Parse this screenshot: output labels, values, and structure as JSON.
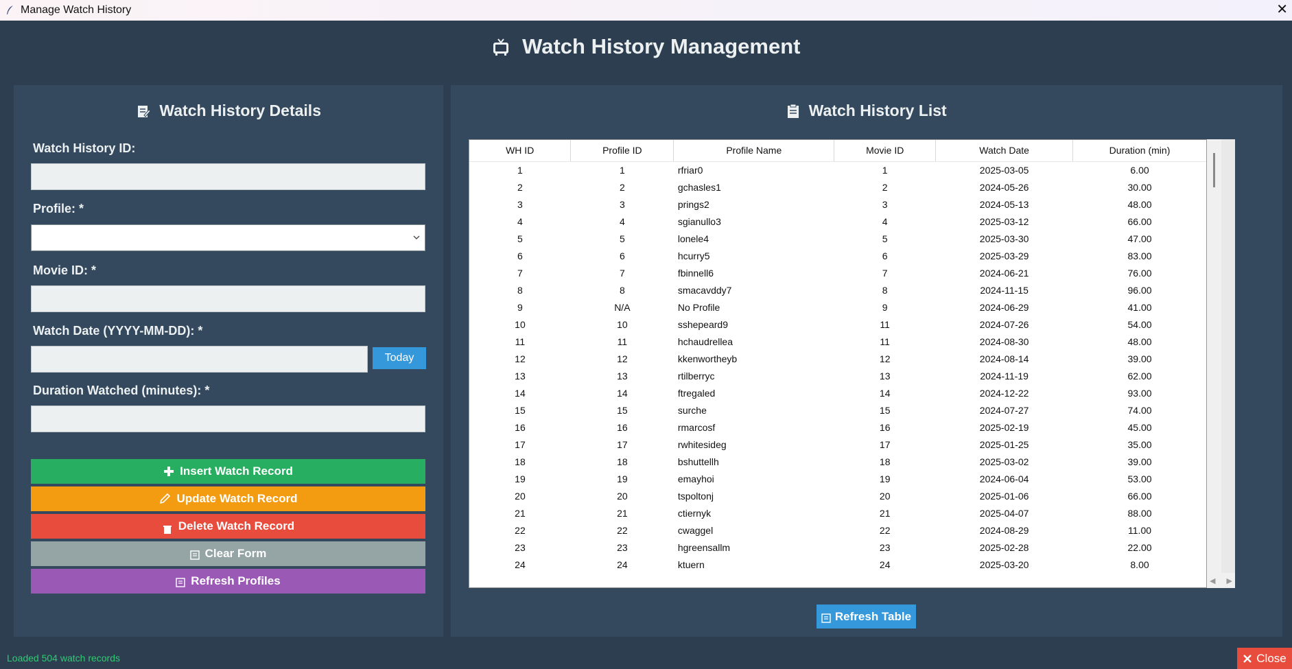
{
  "window": {
    "title": "Manage Watch History"
  },
  "header": {
    "title": "Watch History Management"
  },
  "details": {
    "title": "Watch History Details",
    "labels": {
      "wh_id": "Watch History ID:",
      "profile": "Profile: *",
      "movie_id": "Movie ID: *",
      "watch_date": "Watch Date (YYYY-MM-DD): *",
      "duration": "Duration Watched (minutes): *"
    },
    "values": {
      "wh_id": "",
      "profile": "",
      "movie_id": "",
      "watch_date": "",
      "duration": ""
    },
    "today_label": "Today",
    "buttons": {
      "insert": "Insert Watch Record",
      "update": "Update Watch Record",
      "delete": "Delete Watch Record",
      "clear": "Clear Form",
      "refresh_profiles": "Refresh Profiles"
    }
  },
  "list": {
    "title": "Watch History List",
    "columns": [
      "WH ID",
      "Profile ID",
      "Profile Name",
      "Movie ID",
      "Watch Date",
      "Duration (min)"
    ],
    "rows": [
      [
        "1",
        "1",
        "rfriar0",
        "1",
        "2025-03-05",
        "6.00"
      ],
      [
        "2",
        "2",
        "gchasles1",
        "2",
        "2024-05-26",
        "30.00"
      ],
      [
        "3",
        "3",
        "prings2",
        "3",
        "2024-05-13",
        "48.00"
      ],
      [
        "4",
        "4",
        "sgianullo3",
        "4",
        "2025-03-12",
        "66.00"
      ],
      [
        "5",
        "5",
        "lonele4",
        "5",
        "2025-03-30",
        "47.00"
      ],
      [
        "6",
        "6",
        "hcurry5",
        "6",
        "2025-03-29",
        "83.00"
      ],
      [
        "7",
        "7",
        "fbinnell6",
        "7",
        "2024-06-21",
        "76.00"
      ],
      [
        "8",
        "8",
        "smacavddy7",
        "8",
        "2024-11-15",
        "96.00"
      ],
      [
        "9",
        "N/A",
        "No Profile",
        "9",
        "2024-06-29",
        "41.00"
      ],
      [
        "10",
        "10",
        "sshepeard9",
        "11",
        "2024-07-26",
        "54.00"
      ],
      [
        "11",
        "11",
        "hchaudrellea",
        "11",
        "2024-08-30",
        "48.00"
      ],
      [
        "12",
        "12",
        "kkenwortheyb",
        "12",
        "2024-08-14",
        "39.00"
      ],
      [
        "13",
        "13",
        "rtilberryc",
        "13",
        "2024-11-19",
        "62.00"
      ],
      [
        "14",
        "14",
        "ftregaled",
        "14",
        "2024-12-22",
        "93.00"
      ],
      [
        "15",
        "15",
        "surche",
        "15",
        "2024-07-27",
        "74.00"
      ],
      [
        "16",
        "16",
        "rmarcosf",
        "16",
        "2025-02-19",
        "45.00"
      ],
      [
        "17",
        "17",
        "rwhitesideg",
        "17",
        "2025-01-25",
        "35.00"
      ],
      [
        "18",
        "18",
        "bshuttellh",
        "18",
        "2025-03-02",
        "39.00"
      ],
      [
        "19",
        "19",
        "emayhoi",
        "19",
        "2024-06-04",
        "53.00"
      ],
      [
        "20",
        "20",
        "tspoltonj",
        "20",
        "2025-01-06",
        "66.00"
      ],
      [
        "21",
        "21",
        "ctiernyk",
        "21",
        "2025-04-07",
        "88.00"
      ],
      [
        "22",
        "22",
        "cwaggel",
        "22",
        "2024-08-29",
        "11.00"
      ],
      [
        "23",
        "23",
        "hgreensallm",
        "23",
        "2025-02-28",
        "22.00"
      ],
      [
        "24",
        "24",
        "ktuern",
        "24",
        "2025-03-20",
        "8.00"
      ]
    ],
    "refresh_label": "Refresh Table"
  },
  "status": {
    "text": "Loaded 504 watch records"
  },
  "close_label": "Close",
  "colors": {
    "background": "#2c3e50",
    "panel": "#34495e",
    "insert": "#27ae60",
    "update": "#f39c12",
    "delete": "#e74c3c",
    "clear": "#95a5a6",
    "refresh_profiles": "#9b59b6",
    "refresh_table": "#3498db",
    "status": "#2ecc71"
  },
  "icons": {
    "app": "feather-icon",
    "header": "tv-icon",
    "details": "edit-document-icon",
    "list": "clipboard-icon",
    "insert": "plus-icon",
    "update": "pencil-icon",
    "delete": "trash-icon",
    "clear": "document-icon",
    "refresh": "document-icon",
    "close": "close-icon"
  }
}
